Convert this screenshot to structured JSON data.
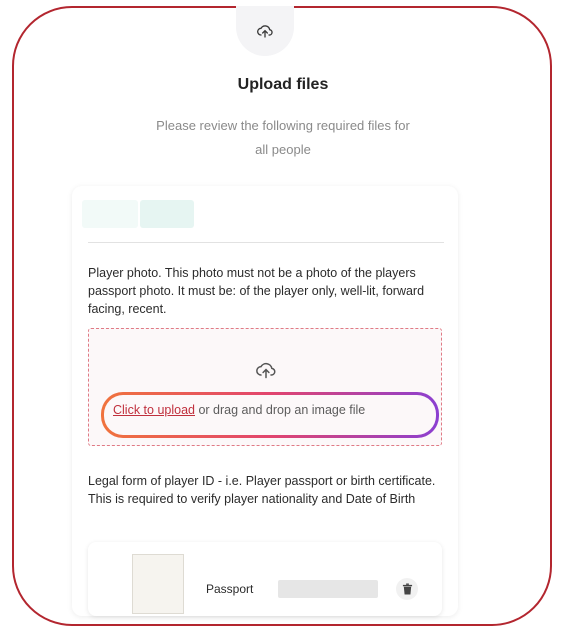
{
  "header": {
    "icon": "upload-cloud-icon",
    "title": "Upload files",
    "subtitle": "Please review the following required files for all people"
  },
  "sections": [
    {
      "description": "Player photo. This photo must not be a photo of the players passport photo. It must be: of the player only, well-lit, forward facing, recent.",
      "dropzone": {
        "icon": "upload-cloud-icon",
        "link_label": "Click to upload",
        "rest_label": " or drag and drop an image file"
      }
    },
    {
      "description": "Legal form of player ID - i.e. Player passport or birth certificate. This is required to verify player nationality and Date of Birth",
      "file": {
        "name": "Passport",
        "delete_icon": "trash-icon"
      }
    }
  ],
  "colors": {
    "frame": "#b3262f",
    "link": "#c0303d",
    "dropzone_border": "#e07a85"
  }
}
